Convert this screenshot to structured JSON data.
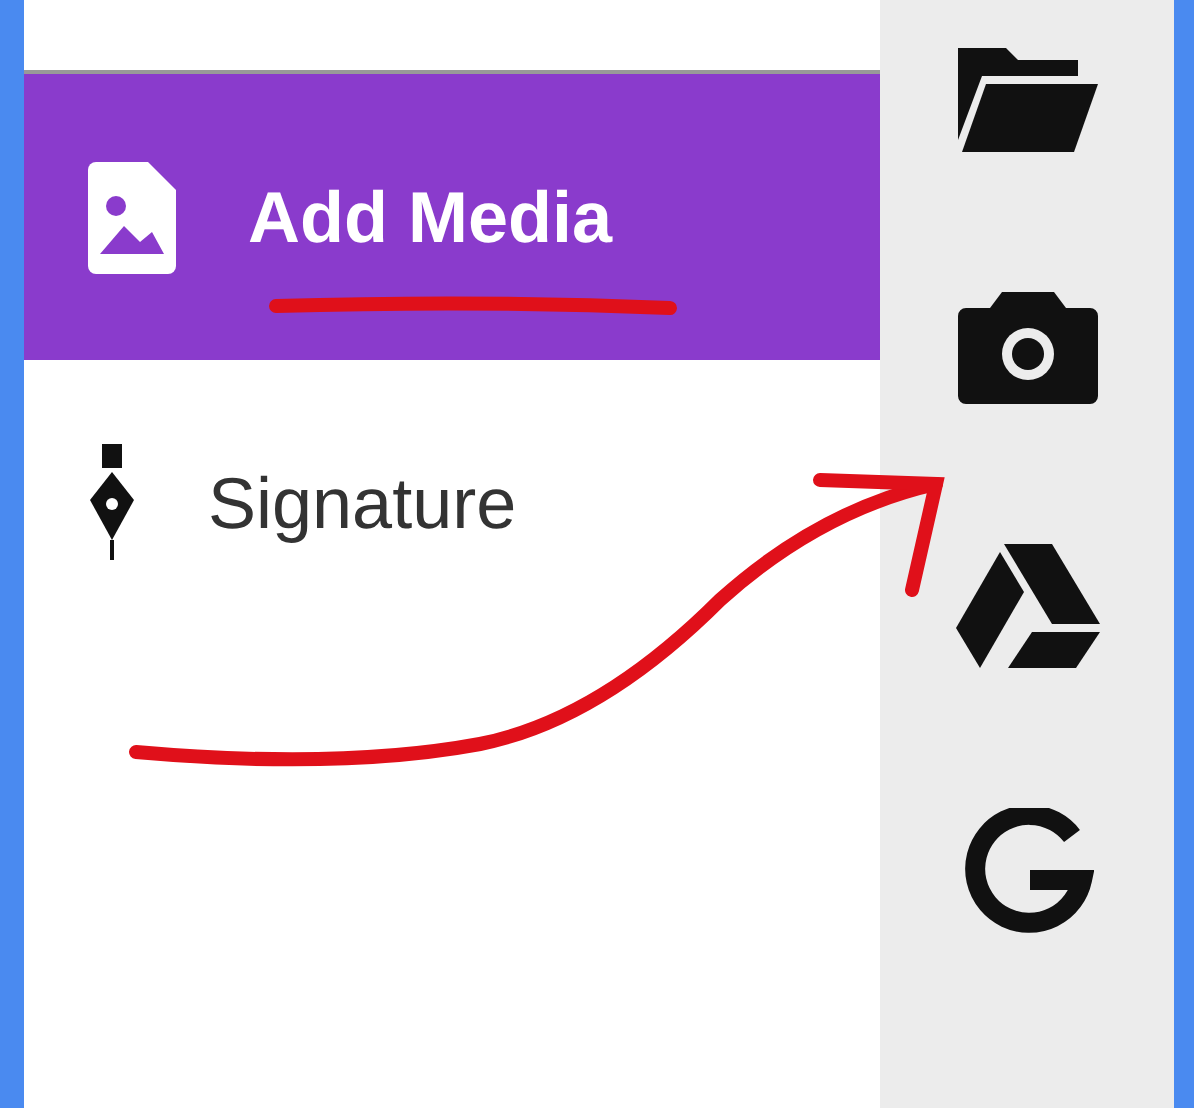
{
  "menu": [
    {
      "label": "Add Media",
      "kind": "media",
      "selected": true
    },
    {
      "label": "Signature",
      "kind": "pen",
      "selected": false
    }
  ],
  "toolbar": [
    {
      "kind": "folder"
    },
    {
      "kind": "camera"
    },
    {
      "kind": "drive"
    },
    {
      "kind": "google"
    }
  ]
}
